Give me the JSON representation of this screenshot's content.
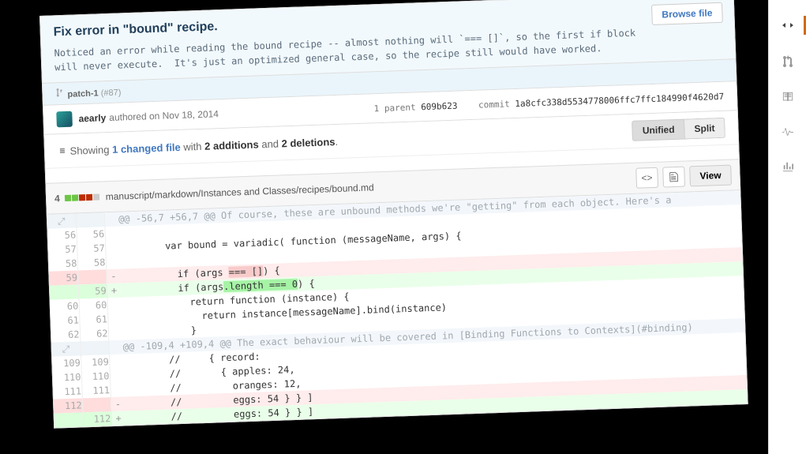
{
  "commit": {
    "title": "Fix error in \"bound\" recipe.",
    "description": "Noticed an error while reading the bound recipe -- almost nothing will `=== []`, so the first if block\nwill never execute.  It's just an optimized general case, so the recipe still would have worked.",
    "branch_name": "patch-1",
    "pr_ref": "(#87)",
    "browse_file_label": "Browse file"
  },
  "author": {
    "name": "aearly",
    "meta": "authored on Nov 18, 2014",
    "parent_label": "1 parent",
    "parent_sha": "609b623",
    "commit_label": "commit",
    "commit_sha": "1a8cfc338d5534778006ffc7ffc184990f4620d7"
  },
  "toc": {
    "prefix": "Showing",
    "changed": "1 changed file",
    "mid1": "with",
    "adds": "2 additions",
    "mid2": "and",
    "dels": "2 deletions",
    "unified": "Unified",
    "split": "Split"
  },
  "file": {
    "stat_num": "4",
    "path": "manuscript/markdown/Instances and Classes/recipes/bound.md",
    "view_label": "View"
  },
  "hunks": {
    "h1": "@@ -56,7 +56,7 @@ Of course, these are unbound methods we're \"getting\" from each object. Here's a",
    "h2": "@@ -109,4 +109,4 @@ The exact behaviour will be covered in [Binding Functions to Contexts](#binding)"
  },
  "lines": {
    "l56": "        var bound = variadic( function (messageName, args) {",
    "l57": "",
    "l58": "",
    "del1_pre": "          if (args ",
    "del1_hl": "=== []",
    "del1_post": ") {",
    "add1_pre": "          if (args",
    "add1_hl": ".length === 0",
    "add1_post": ") {",
    "l60": "            return function (instance) {",
    "l61": "              return instance[messageName].bind(instance)",
    "l62": "            }",
    "l109": "        //     { record:",
    "l110": "        //       { apples: 24,",
    "l111": "        //         oranges: 12,",
    "del2": "        //         eggs: 54 } } ]",
    "add2": "        //         eggs: 54 } } ]"
  },
  "nums": {
    "n56": "56",
    "n57": "57",
    "n58": "58",
    "n59": "59",
    "n60": "60",
    "n61": "61",
    "n62": "62",
    "n109": "109",
    "n110": "110",
    "n111": "111",
    "n112": "112"
  }
}
